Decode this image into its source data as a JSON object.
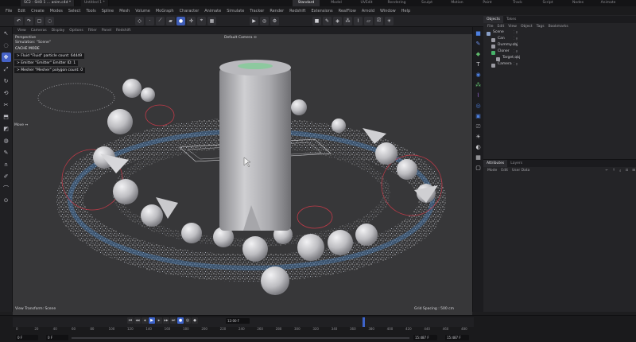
{
  "titlebar": {
    "tabs": [
      "SC2 - SHO 1 ... anim.c4d *",
      "Untitled 1 *"
    ],
    "layouts": [
      "Standard",
      "Model",
      "UVEdit",
      "Rendering",
      "Sculpt",
      "Motion",
      "Paint",
      "Track",
      "Script",
      "Nodes",
      "Animate"
    ],
    "active_layout": "Standard"
  },
  "menubar": {
    "items": [
      "File",
      "Edit",
      "Create",
      "Modes",
      "Select",
      "Tools",
      "Spline",
      "Mesh",
      "Volume",
      "MoGraph",
      "Character",
      "Animate",
      "Simulate",
      "Tracker",
      "Render",
      "Redshift",
      "Extensions",
      "RealFlow",
      "Arnold",
      "Window",
      "Help"
    ]
  },
  "viewport": {
    "menu": [
      "View",
      "Cameras",
      "Display",
      "Options",
      "Filter",
      "Panel",
      "Redshift"
    ],
    "view_name": "Perspective",
    "simulation": "Simulation: \"Scene\"",
    "camera": "Default Camera ⊙",
    "cache_mode": "CACHE MODE",
    "info_lines": [
      "> Fluid \"Fluid\" particle count: 64449",
      "> Emitter \"Emitter\" Emitter ID: 1",
      "> Mesher \"Mesher\" polygon count: 0"
    ],
    "move_label": "Move ↔",
    "view_transform": "View Transform: Scene",
    "grid_spacing": "Grid Spacing : 500 cm"
  },
  "objects": {
    "tabs": [
      "Objects",
      "Takes"
    ],
    "menu": [
      "File",
      "Edit",
      "View",
      "Object",
      "Tags",
      "Bookmarks"
    ],
    "rows": [
      {
        "name": "Scene",
        "color": "#8aa0c8"
      },
      {
        "name": "Can",
        "color": "#9b9ba3"
      },
      {
        "name": "Dummy.obj",
        "color": "#9b9ba3"
      },
      {
        "name": "Cloner",
        "color": "#47b36a"
      },
      {
        "name": "Target.obj",
        "color": "#9b9ba3"
      },
      {
        "name": "Camera",
        "color": "#9b9ba3"
      }
    ]
  },
  "attributes": {
    "tabs": [
      "Attributes",
      "Layers"
    ],
    "menu": [
      "Mode",
      "Edit",
      "User Data"
    ]
  },
  "timeline": {
    "start": "0 F",
    "current": "0 F",
    "frame_field": "12:00 F",
    "end_field": "15:487 F",
    "end_field2": "15:487 F",
    "ticks": [
      "0",
      "20",
      "40",
      "60",
      "80",
      "100",
      "120",
      "140",
      "160",
      "180",
      "200",
      "220",
      "240",
      "260",
      "280",
      "300",
      "320",
      "340",
      "360",
      "380",
      "400",
      "420",
      "440",
      "460",
      "480"
    ],
    "left_fields": [
      "0 F",
      "0 F"
    ]
  },
  "colors": {
    "accent": "#3e5db8",
    "viewport_bg": "#373739",
    "particles_blue": "#4a8fd8",
    "ring_red": "#c23a48"
  }
}
